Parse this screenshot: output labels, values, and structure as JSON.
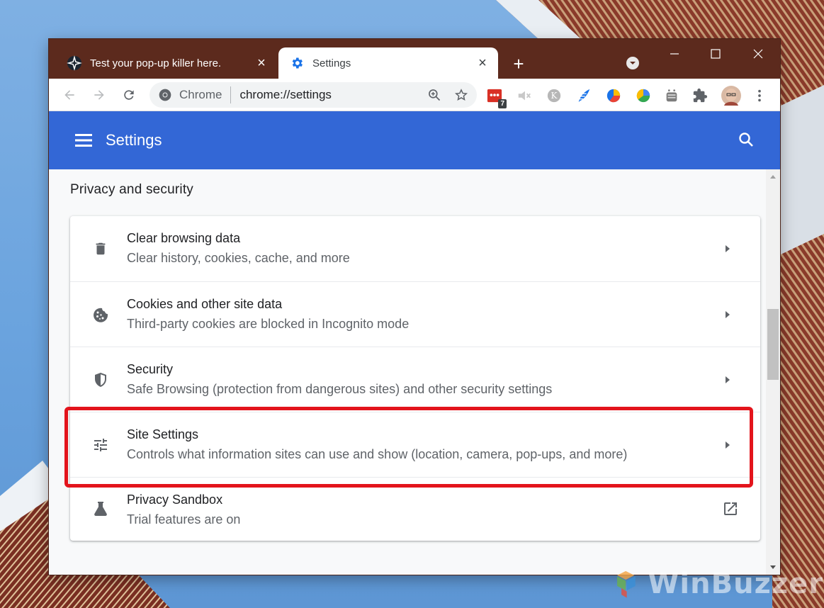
{
  "browser": {
    "tabs": [
      {
        "title": "Test your pop-up killer here.",
        "close": "×",
        "active": false
      },
      {
        "title": "Settings",
        "close": "×",
        "active": true
      }
    ],
    "new_tab": "+",
    "window_controls": {
      "minimize": "minimize-icon",
      "maximize": "maximize-icon",
      "close": "close-icon"
    },
    "omnibox": {
      "scheme_label": "Chrome",
      "url": "chrome://settings"
    },
    "extensions": [
      {
        "icon": "todo-extension-icon",
        "badge": "7"
      },
      {
        "icon": "speaker-extension-icon"
      },
      {
        "icon": "k-extension-icon"
      },
      {
        "icon": "feather-extension-icon"
      },
      {
        "icon": "pie-extension-icon"
      },
      {
        "icon": "chart-extension-icon"
      },
      {
        "icon": "robot-extension-icon"
      },
      {
        "icon": "puzzle-icon"
      },
      {
        "icon": "profile-avatar"
      },
      {
        "icon": "more-vert-icon"
      }
    ]
  },
  "settings": {
    "title": "Settings",
    "section_title": "Privacy and security",
    "rows": [
      {
        "label": "Clear browsing data",
        "sub": "Clear history, cookies, cache, and more",
        "icon": "trash-icon",
        "action": "arrow"
      },
      {
        "label": "Cookies and other site data",
        "sub": "Third-party cookies are blocked in Incognito mode",
        "icon": "cookie-icon",
        "action": "arrow"
      },
      {
        "label": "Security",
        "sub": "Safe Browsing (protection from dangerous sites) and other security settings",
        "icon": "shield-icon",
        "action": "arrow"
      },
      {
        "label": "Site Settings",
        "sub": "Controls what information sites can use and show (location, camera, pop-ups, and more)",
        "icon": "tune-icon",
        "action": "arrow",
        "highlighted": true
      },
      {
        "label": "Privacy Sandbox",
        "sub": "Trial features are on",
        "icon": "flask-icon",
        "action": "external-link"
      }
    ]
  },
  "colors": {
    "tabstrip": "#5c2a1d",
    "header": "#3367d6",
    "highlight": "#e3141c"
  },
  "watermark": "WinBuzzer"
}
